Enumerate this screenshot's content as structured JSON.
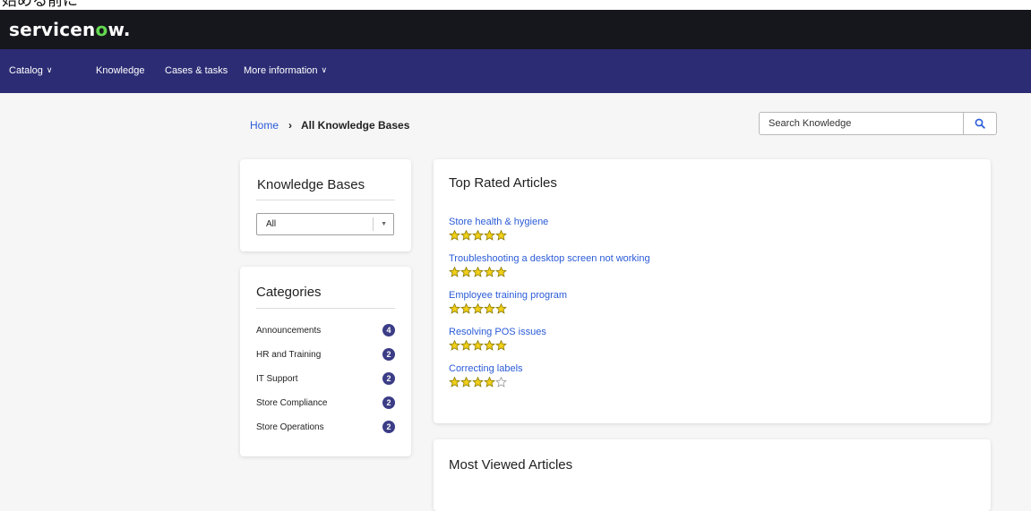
{
  "caption": "始める前に",
  "brand": {
    "logo_pre": "servicen",
    "logo_o": "o",
    "logo_post": "w",
    "logo_dot": "."
  },
  "nav": {
    "items": [
      {
        "label": "Catalog",
        "has_dropdown": true
      },
      {
        "label": "Knowledge",
        "has_dropdown": false
      },
      {
        "label": "Cases & tasks",
        "has_dropdown": false
      },
      {
        "label": "More information",
        "has_dropdown": true
      }
    ]
  },
  "breadcrumb": {
    "home": "Home",
    "separator": "›",
    "current": "All Knowledge Bases"
  },
  "search": {
    "placeholder": "Search Knowledge",
    "icon": "search-icon"
  },
  "knowledge_bases": {
    "title": "Knowledge Bases",
    "selected": "All"
  },
  "categories": {
    "title": "Categories",
    "items": [
      {
        "label": "Announcements",
        "count": "4"
      },
      {
        "label": "HR and Training",
        "count": "2"
      },
      {
        "label": "IT Support",
        "count": "2"
      },
      {
        "label": "Store Compliance",
        "count": "2"
      },
      {
        "label": "Store Operations",
        "count": "2"
      }
    ]
  },
  "top_rated": {
    "title": "Top Rated Articles",
    "articles": [
      {
        "title": "Store health & hygiene",
        "rating": 5
      },
      {
        "title": "Troubleshooting a desktop screen not working",
        "rating": 5
      },
      {
        "title": "Employee training program",
        "rating": 5
      },
      {
        "title": "Resolving POS issues",
        "rating": 5
      },
      {
        "title": "Correcting labels",
        "rating": 4
      }
    ],
    "max_rating": 5
  },
  "most_viewed": {
    "title": "Most Viewed Articles"
  },
  "colors": {
    "topbar": "#16161d",
    "navbar": "#2c2c75",
    "link": "#2a5bd7",
    "badge": "#3b3d86",
    "star_fill": "#f2d019",
    "star_stroke": "#8a7a00",
    "logo_accent": "#62d84e"
  }
}
